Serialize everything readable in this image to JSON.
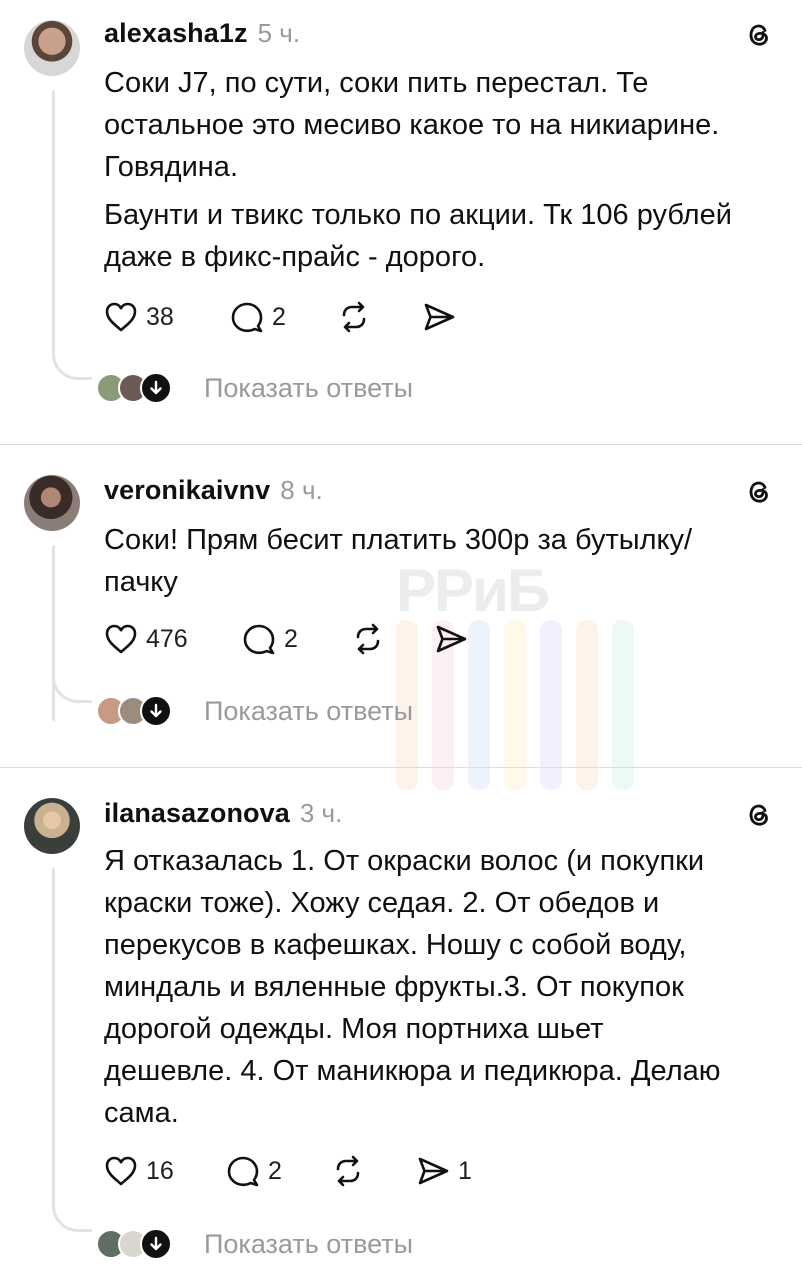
{
  "watermark": "РРиБ",
  "replies_label": "Показать ответы",
  "posts": [
    {
      "username": "alexasha1z",
      "time": "5 ч.",
      "lines": [
        "Соки J7, по сути, соки пить перестал. Те",
        "остальное это месиво какое то на никиарине.",
        "Говядина.",
        "Баунти и твикс только по акции. Тк 106 рублей",
        "даже в фикс-прайс - дорого."
      ],
      "likes": "38",
      "comments": "2",
      "reposts": "",
      "shares": ""
    },
    {
      "username": "veronikaivnv",
      "time": "8 ч.",
      "lines": [
        "Соки! Прям бесит платить 300р за бутылку/",
        "пачку"
      ],
      "likes": "476",
      "comments": "2",
      "reposts": "",
      "shares": ""
    },
    {
      "username": "ilanasazonova",
      "time": "3 ч.",
      "lines": [
        "Я отказалась 1. От окраски волос (и покупки",
        "краски тоже). Хожу седая. 2. От обедов и",
        "перекусов в кафешках. Ношу с собой воду,",
        "миндаль и вяленные фрукты.3. От покупок",
        "дорогой одежды. Моя портниха шьет",
        "дешевле. 4. От маникюра и педикюра. Делаю",
        "сама."
      ],
      "likes": "16",
      "comments": "2",
      "reposts": "",
      "shares": "1"
    }
  ],
  "icons": {
    "like": "heart-icon",
    "comment": "comment-icon",
    "repost": "repost-icon",
    "share": "send-icon",
    "logo": "threads-logo-icon",
    "expand": "arrow-down-icon"
  }
}
